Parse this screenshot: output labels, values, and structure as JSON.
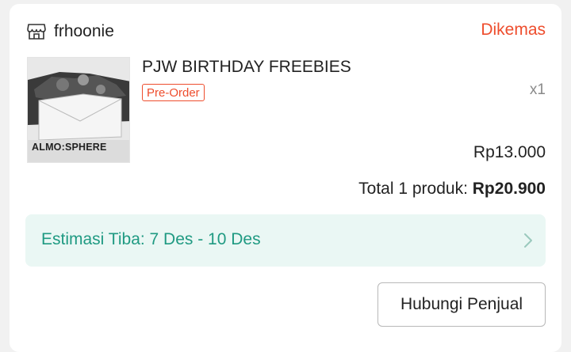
{
  "order": {
    "shop_name": "frhoonie",
    "status": "Dikemas",
    "product": {
      "title": "PJW BIRTHDAY FREEBIES",
      "badge": "Pre-Order",
      "quantity": "x1",
      "price": "Rp13.000",
      "thumbnail_text": "ALMO:SPHERE"
    },
    "total_label": "Total 1 produk:",
    "total_amount": "Rp20.900",
    "eta": "Estimasi Tiba: 7 Des - 10 Des",
    "contact_button": "Hubungi Penjual"
  },
  "colors": {
    "accent": "#ee4d2d",
    "eta_text": "#1f9a82",
    "eta_background": "#eaf7f4"
  },
  "icons": {
    "shop": "shop-icon",
    "eta_arrow": "chevron-right-icon"
  }
}
